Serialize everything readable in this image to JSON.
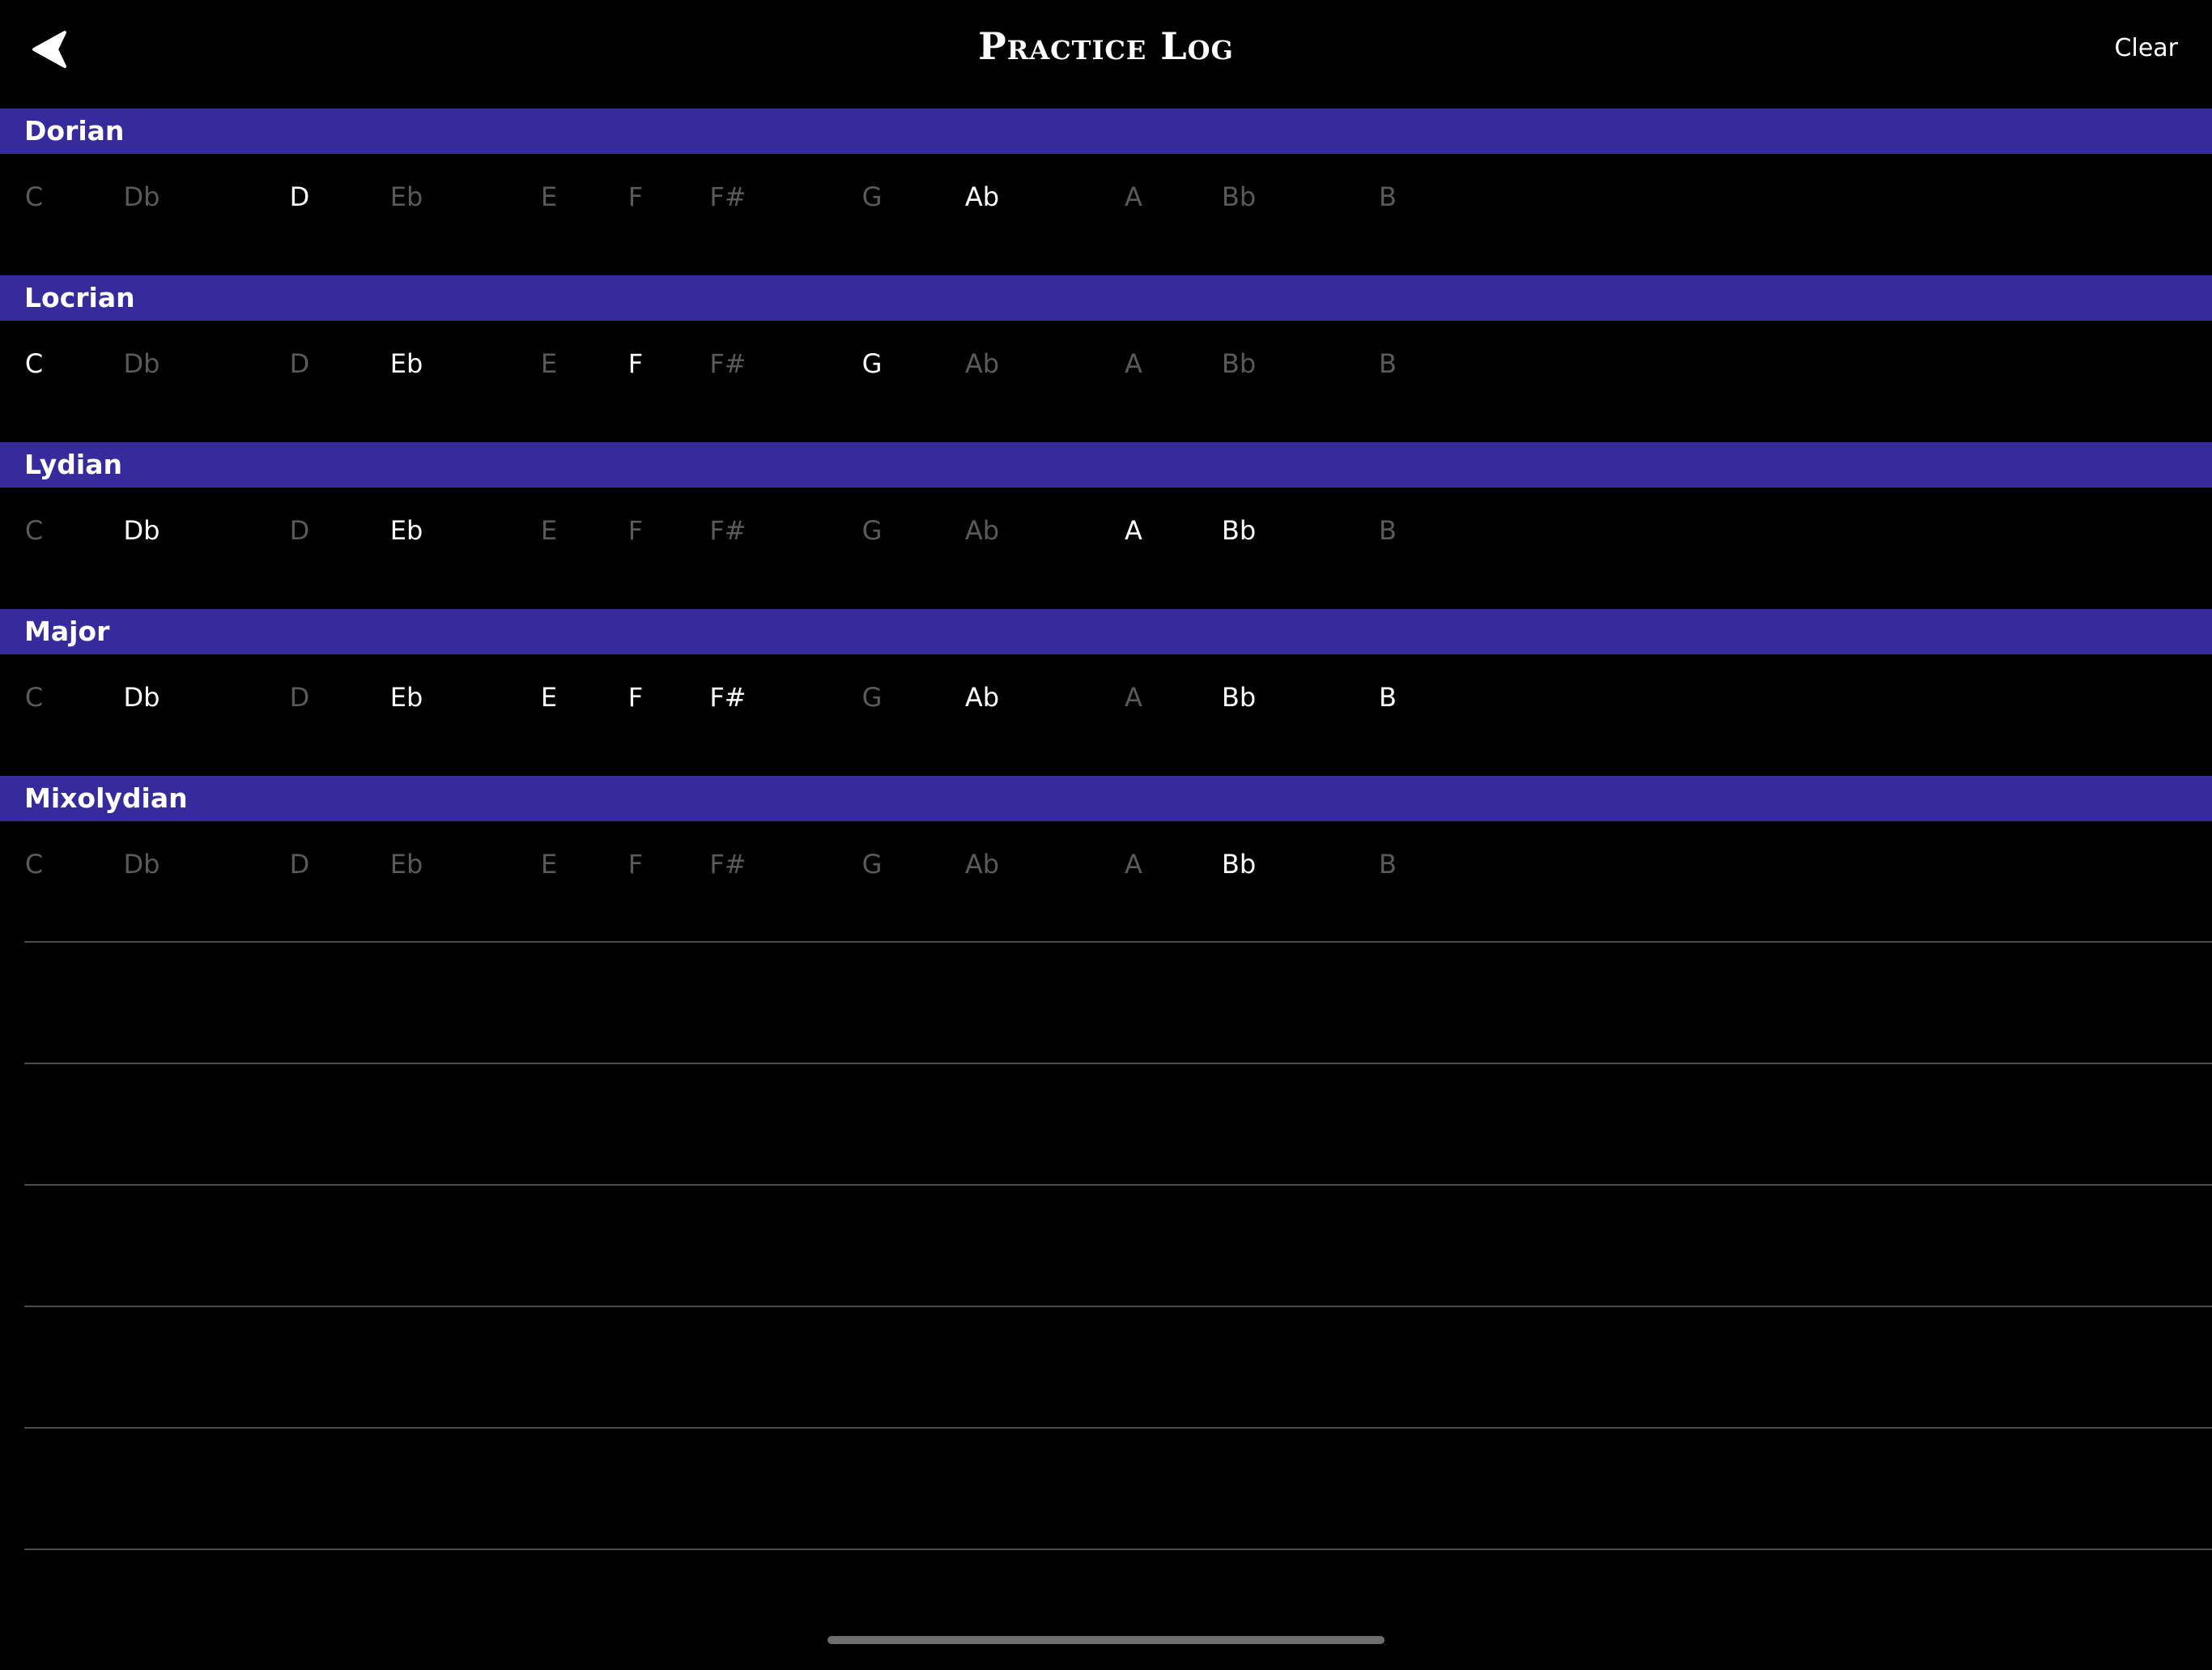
{
  "nav": {
    "back_icon": "chevron-left-icon",
    "title": "Practice Log",
    "clear_label": "Clear"
  },
  "keys": [
    "C",
    "Db",
    "D",
    "Eb",
    "E",
    "F",
    "F#",
    "G",
    "Ab",
    "A",
    "Bb",
    "B"
  ],
  "sections": [
    {
      "name": "Dorian",
      "keys": [
        {
          "label": "C",
          "practiced": false
        },
        {
          "label": "Db",
          "practiced": false
        },
        {
          "label": "D",
          "practiced": true
        },
        {
          "label": "Eb",
          "practiced": false
        },
        {
          "label": "E",
          "practiced": false
        },
        {
          "label": "F",
          "practiced": false
        },
        {
          "label": "F#",
          "practiced": false
        },
        {
          "label": "G",
          "practiced": false
        },
        {
          "label": "Ab",
          "practiced": true
        },
        {
          "label": "A",
          "practiced": false
        },
        {
          "label": "Bb",
          "practiced": false
        },
        {
          "label": "B",
          "practiced": false
        }
      ]
    },
    {
      "name": "Locrian",
      "keys": [
        {
          "label": "C",
          "practiced": true
        },
        {
          "label": "Db",
          "practiced": false
        },
        {
          "label": "D",
          "practiced": false
        },
        {
          "label": "Eb",
          "practiced": true
        },
        {
          "label": "E",
          "practiced": false
        },
        {
          "label": "F",
          "practiced": true
        },
        {
          "label": "F#",
          "practiced": false
        },
        {
          "label": "G",
          "practiced": true
        },
        {
          "label": "Ab",
          "practiced": false
        },
        {
          "label": "A",
          "practiced": false
        },
        {
          "label": "Bb",
          "practiced": false
        },
        {
          "label": "B",
          "practiced": false
        }
      ]
    },
    {
      "name": "Lydian",
      "keys": [
        {
          "label": "C",
          "practiced": false
        },
        {
          "label": "Db",
          "practiced": true
        },
        {
          "label": "D",
          "practiced": false
        },
        {
          "label": "Eb",
          "practiced": true
        },
        {
          "label": "E",
          "practiced": false
        },
        {
          "label": "F",
          "practiced": false
        },
        {
          "label": "F#",
          "practiced": false
        },
        {
          "label": "G",
          "practiced": false
        },
        {
          "label": "Ab",
          "practiced": false
        },
        {
          "label": "A",
          "practiced": true
        },
        {
          "label": "Bb",
          "practiced": true
        },
        {
          "label": "B",
          "practiced": false
        }
      ]
    },
    {
      "name": "Major",
      "keys": [
        {
          "label": "C",
          "practiced": false
        },
        {
          "label": "Db",
          "practiced": true
        },
        {
          "label": "D",
          "practiced": false
        },
        {
          "label": "Eb",
          "practiced": true
        },
        {
          "label": "E",
          "practiced": true
        },
        {
          "label": "F",
          "practiced": true
        },
        {
          "label": "F#",
          "practiced": true
        },
        {
          "label": "G",
          "practiced": false
        },
        {
          "label": "Ab",
          "practiced": true
        },
        {
          "label": "A",
          "practiced": false
        },
        {
          "label": "Bb",
          "practiced": true
        },
        {
          "label": "B",
          "practiced": true
        }
      ]
    },
    {
      "name": "Mixolydian",
      "keys": [
        {
          "label": "C",
          "practiced": false
        },
        {
          "label": "Db",
          "practiced": false
        },
        {
          "label": "D",
          "practiced": false
        },
        {
          "label": "Eb",
          "practiced": false
        },
        {
          "label": "E",
          "practiced": false
        },
        {
          "label": "F",
          "practiced": false
        },
        {
          "label": "F#",
          "practiced": false
        },
        {
          "label": "G",
          "practiced": false
        },
        {
          "label": "Ab",
          "practiced": false
        },
        {
          "label": "A",
          "practiced": false
        },
        {
          "label": "Bb",
          "practiced": true
        },
        {
          "label": "B",
          "practiced": false
        }
      ]
    }
  ],
  "colors": {
    "section_header": "#352b9c",
    "practiced_key": "#ffffff",
    "unpracticed_key": "#5a5a5a",
    "background": "#000000"
  }
}
